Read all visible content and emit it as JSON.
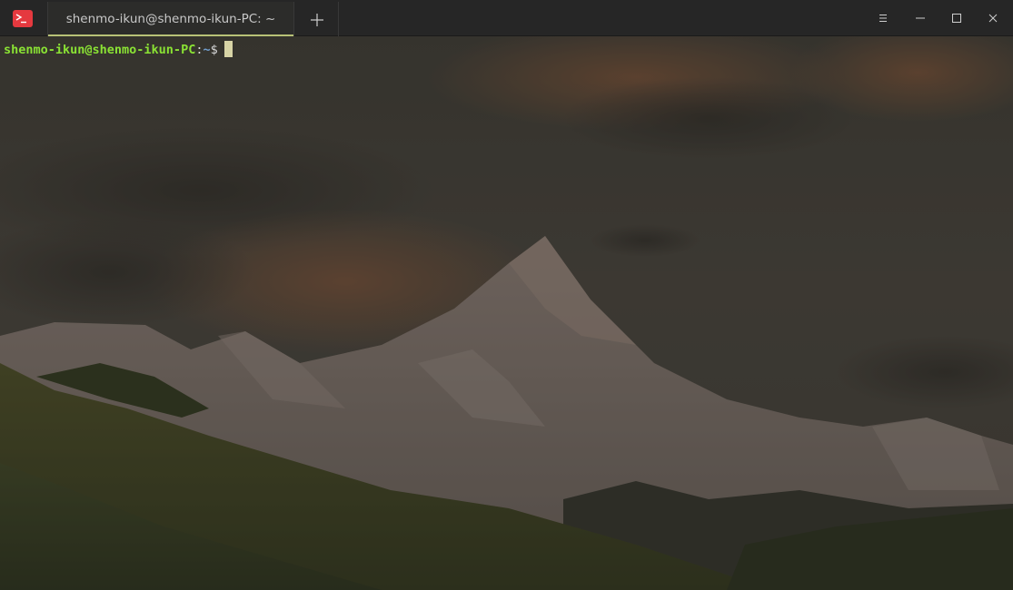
{
  "window": {
    "tab_title": "shenmo-ikun@shenmo-ikun-PC: ~",
    "app_icon": "terminal-icon",
    "controls": [
      "menu-icon",
      "minimize-icon",
      "maximize-icon",
      "close-icon"
    ],
    "new_tab_icon": "plus-icon"
  },
  "terminal": {
    "prompt_user_host": "shenmo-ikun@shenmo-ikun-PC",
    "prompt_colon": ":",
    "prompt_path": "~",
    "prompt_symbol": "$"
  },
  "colors": {
    "titlebar": "#262626",
    "tab_accent": "#b8c277",
    "prompt_user": "#8ae234",
    "prompt_path": "#729fcf",
    "app_icon": "#e5393f",
    "cursor": "#d8d4a6"
  }
}
